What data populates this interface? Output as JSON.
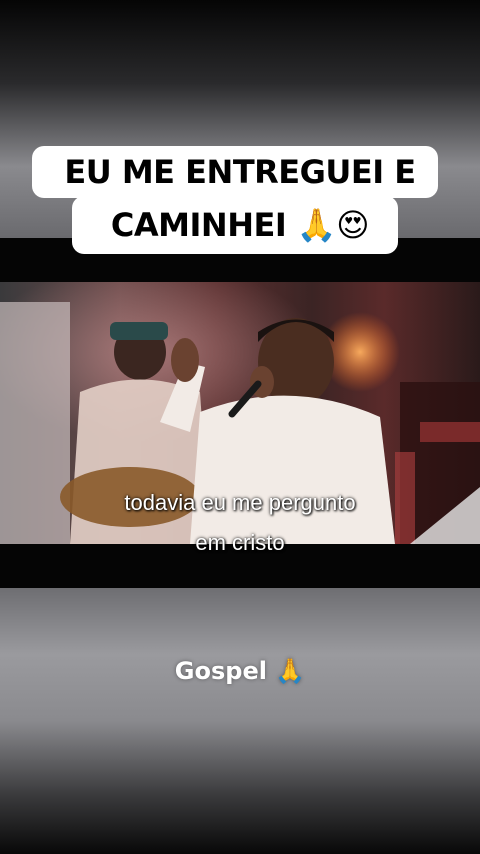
{
  "overlay": {
    "title_line1": "EU ME ENTREGUEI E",
    "title_line2": "CAMINHEI 🙏😍"
  },
  "video": {
    "subtitle_line1": "todavia eu me pergunto",
    "subtitle_line2": "em cristo"
  },
  "footer": {
    "label": "Gospel 🙏"
  }
}
